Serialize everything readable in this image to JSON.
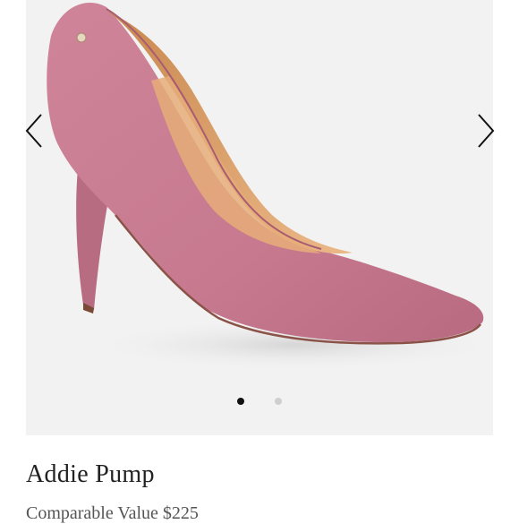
{
  "product": {
    "title": "Addie Pump",
    "comparable_value": "Comparable Value $225"
  },
  "carousel": {
    "slide_count": 2,
    "active_index": 1,
    "prev_icon": "chevron-left-icon",
    "next_icon": "chevron-right-icon"
  },
  "colors": {
    "shoe_suede": "#c9788f",
    "lining": "#e3a772",
    "background": "#f2f2f2",
    "dot_active": "#111111",
    "dot_inactive": "#cfcfcf"
  }
}
